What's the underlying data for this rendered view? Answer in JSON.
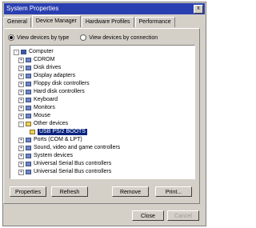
{
  "window": {
    "title": "System Properties",
    "close_glyph": "x"
  },
  "tabs": [
    {
      "label": "General"
    },
    {
      "label": "Device Manager"
    },
    {
      "label": "Hardware Profiles"
    },
    {
      "label": "Performance"
    }
  ],
  "view_options": {
    "by_type": "View devices by type",
    "by_connection": "View devices by connection"
  },
  "tree": {
    "root": "Computer",
    "items": [
      {
        "label": "CDROM",
        "icon": "cdrom-icon"
      },
      {
        "label": "Disk drives",
        "icon": "disk-icon"
      },
      {
        "label": "Display adapters",
        "icon": "display-icon"
      },
      {
        "label": "Floppy disk controllers",
        "icon": "floppy-icon"
      },
      {
        "label": "Hard disk controllers",
        "icon": "hdd-icon"
      },
      {
        "label": "Keyboard",
        "icon": "keyboard-icon"
      },
      {
        "label": "Monitors",
        "icon": "monitor-icon"
      },
      {
        "label": "Mouse",
        "icon": "mouse-icon"
      },
      {
        "label": "Other devices",
        "icon": "warning-icon"
      },
      {
        "label": "USB PS/2 BOOTS",
        "icon": "warning-icon",
        "selected": true
      },
      {
        "label": "Ports (COM & LPT)",
        "icon": "port-icon"
      },
      {
        "label": "Sound, video and game controllers",
        "icon": "sound-icon"
      },
      {
        "label": "System devices",
        "icon": "system-icon"
      },
      {
        "label": "Universal Serial Bus controllers",
        "icon": "usb-icon"
      },
      {
        "label": "Universal Serial Bus controllers",
        "icon": "usb-icon"
      }
    ]
  },
  "actions": {
    "properties": "Properties",
    "refresh": "Refresh",
    "remove": "Remove",
    "print": "Print..."
  },
  "footer": {
    "close": "Close",
    "cancel": "Cancel"
  }
}
